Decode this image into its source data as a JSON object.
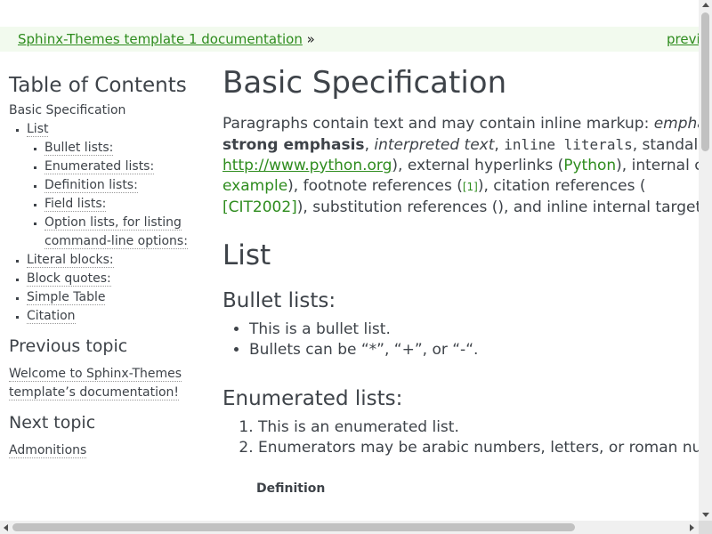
{
  "relbar": {
    "project_link": "Sphinx-Themes template 1 documentation",
    "separator": "»",
    "previous_link": "previous"
  },
  "sidebar": {
    "toc_title": "Table of Contents",
    "toc": {
      "root": "Basic Specification",
      "list": "List",
      "list_children": [
        "Bullet lists:",
        "Enumerated lists:",
        "Definition lists:",
        "Field lists:",
        "Option lists, for listing command-line options:"
      ],
      "siblings": [
        "Literal blocks:",
        "Block quotes:",
        "Simple Table",
        "Citation"
      ]
    },
    "previous_topic_title": "Previous topic",
    "previous_topic_link": "Welcome to Sphinx-Themes template’s documentation!",
    "next_topic_title": "Next topic",
    "next_topic_link": "Admonitions"
  },
  "main": {
    "title": "Basic Specification",
    "intro": {
      "t1": "Paragraphs contain text and may contain inline markup: ",
      "emphasis": "emphasis",
      "t2": ", ",
      "strong": "strong emphasis",
      "t3": ", ",
      "interpreted": "interpreted text",
      "t4": ", ",
      "literals": "inline literals",
      "t5": ", standalone hyperlinks (",
      "url": "http://www.python.org",
      "t6": "), external hyperlinks (",
      "python": "Python",
      "t7": "), internal cross-references (",
      "example": "example",
      "t8": "), footnote references (",
      "footnote": "[1]",
      "t9": "), citation references (",
      "citation": "[CIT2002]",
      "t10": "), substitution references (), and inline internal targets."
    },
    "list_heading": "List",
    "bullet_heading": "Bullet lists:",
    "bullets": [
      "This is a bullet list.",
      "Bullets can be “*”, “+”, or “-“."
    ],
    "enum_heading": "Enumerated lists:",
    "enum_items": [
      "This is an enumerated list.",
      "Enumerators may be arabic numbers, letters, or roman numerals."
    ],
    "def_term": "Definition"
  }
}
